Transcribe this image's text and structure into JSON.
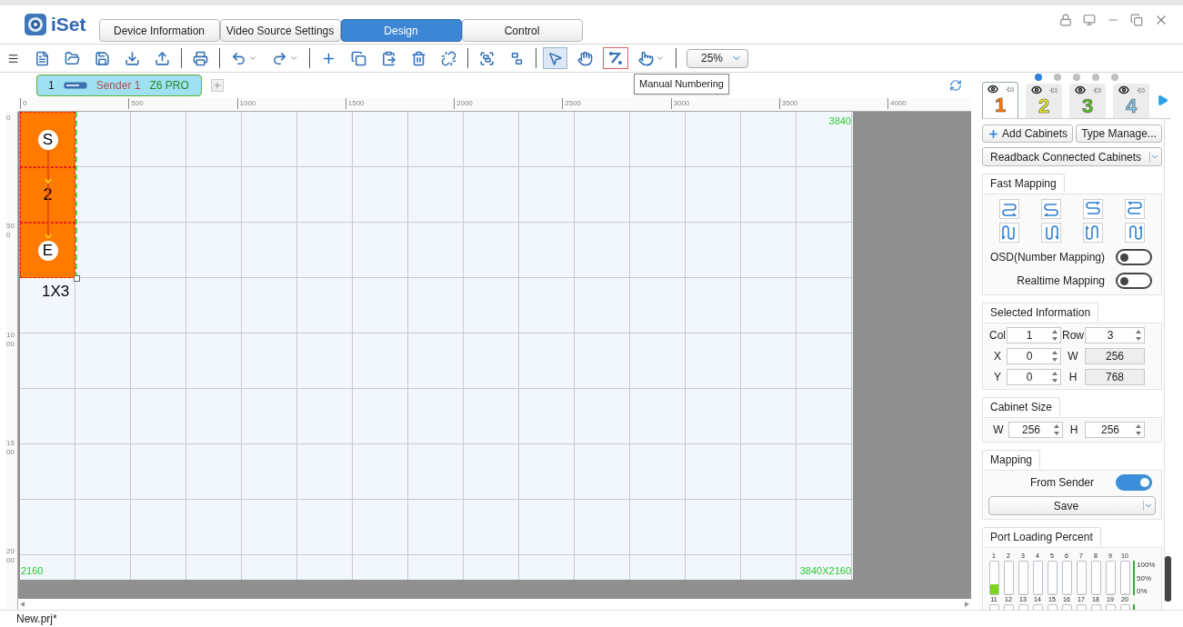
{
  "app": {
    "name": "iSet"
  },
  "tabs": [
    {
      "label": "Device Information",
      "selected": false
    },
    {
      "label": "Video Source Settings",
      "selected": false
    },
    {
      "label": "Design",
      "selected": true
    },
    {
      "label": "Control",
      "selected": false
    }
  ],
  "toolbar": {
    "tools": [
      {
        "kind": "new",
        "selected": false,
        "hovered": false
      },
      {
        "kind": "open",
        "selected": false,
        "hovered": false
      },
      {
        "kind": "save",
        "selected": false,
        "hovered": false
      },
      {
        "kind": "import",
        "selected": false,
        "hovered": false
      },
      {
        "kind": "export",
        "selected": false,
        "hovered": false
      },
      {
        "kind": "sep"
      },
      {
        "kind": "print",
        "selected": false,
        "hovered": false
      },
      {
        "kind": "sep"
      },
      {
        "kind": "undo",
        "selected": false,
        "hovered": false
      },
      {
        "kind": "redo",
        "selected": false,
        "hovered": false
      },
      {
        "kind": "sep"
      },
      {
        "kind": "add",
        "selected": false,
        "hovered": false
      },
      {
        "kind": "copy",
        "selected": false,
        "hovered": false
      },
      {
        "kind": "paste",
        "selected": false,
        "hovered": false
      },
      {
        "kind": "delete",
        "selected": false,
        "hovered": false
      },
      {
        "kind": "unlink",
        "selected": false,
        "hovered": false
      },
      {
        "kind": "sep"
      },
      {
        "kind": "group",
        "selected": false,
        "hovered": false
      },
      {
        "kind": "ungroup",
        "selected": false,
        "hovered": false
      },
      {
        "kind": "sep"
      },
      {
        "kind": "select",
        "selected": true,
        "hovered": false
      },
      {
        "kind": "pan",
        "selected": false,
        "hovered": false
      },
      {
        "kind": "numbering",
        "selected": false,
        "hovered": true
      },
      {
        "kind": "touch",
        "selected": false,
        "hovered": false
      },
      {
        "kind": "sep"
      }
    ],
    "zoom": "25%",
    "tooltip": "Manual Numbering"
  },
  "sender_tab": {
    "index": "1",
    "name": "Sender 1",
    "model": "Z6 PRO",
    "selected": true
  },
  "ruler": {
    "x_labels": [
      "0",
      "500",
      "1000",
      "1500",
      "2000",
      "2500",
      "3000",
      "3500",
      "4000"
    ],
    "y_labels": [
      "0",
      "500",
      "1000",
      "1500",
      "2000"
    ]
  },
  "canvas": {
    "width_label": "3840",
    "height_label": "2160",
    "size_label": "3840X2160",
    "cabinets": [
      {
        "label": "S",
        "kind": "start"
      },
      {
        "label": "2",
        "kind": "middle"
      },
      {
        "label": "E",
        "kind": "end"
      }
    ],
    "group_label": "1X3"
  },
  "layers": {
    "pages": [
      {
        "selected": true
      },
      {
        "selected": false
      },
      {
        "selected": false
      },
      {
        "selected": false
      },
      {
        "selected": false
      }
    ],
    "tabs": [
      {
        "label": "1",
        "color": "#ff7b00",
        "selected": true
      },
      {
        "label": "2",
        "color": "#e3e31e",
        "selected": false
      },
      {
        "label": "3",
        "color": "#55c01a",
        "selected": false
      },
      {
        "label": "4",
        "color": "#7cc4ea",
        "selected": false
      }
    ]
  },
  "panel": {
    "add_button": "Add Cabinets",
    "type_button": "Type Manage...",
    "readback_button": "Readback Connected Cabinets",
    "fast_mapping": {
      "title": "Fast Mapping",
      "toggles": [
        {
          "label": "OSD(Number Mapping)",
          "on": false
        },
        {
          "label": "Realtime Mapping",
          "on": false
        }
      ]
    },
    "selected_info": {
      "title": "Selected Information",
      "fields": [
        {
          "label": "Col",
          "value": "1",
          "kind": "spin"
        },
        {
          "label": "Row",
          "value": "3",
          "kind": "spin"
        },
        {
          "label": "X",
          "value": "0",
          "kind": "spin"
        },
        {
          "label": "W",
          "value": "256",
          "kind": "readonly"
        },
        {
          "label": "Y",
          "value": "0",
          "kind": "spin"
        },
        {
          "label": "H",
          "value": "768",
          "kind": "readonly"
        }
      ]
    },
    "cabinet_size": {
      "title": "Cabinet Size",
      "fields": [
        {
          "label": "W",
          "value": "256",
          "kind": "spin"
        },
        {
          "label": "H",
          "value": "256",
          "kind": "spin"
        }
      ]
    },
    "mapping": {
      "title": "Mapping",
      "toggle": {
        "label": "From Sender",
        "on": true
      },
      "save_button": "Save"
    },
    "port_loading": {
      "title": "Port Loading Percent",
      "rows": [
        {
          "ports": [
            {
              "label": "1",
              "level": 0.3
            },
            {
              "label": "2",
              "level": 0
            },
            {
              "label": "3",
              "level": 0
            },
            {
              "label": "4",
              "level": 0
            },
            {
              "label": "5",
              "level": 0
            },
            {
              "label": "6",
              "level": 0
            },
            {
              "label": "7",
              "level": 0
            },
            {
              "label": "8",
              "level": 0
            },
            {
              "label": "9",
              "level": 0
            },
            {
              "label": "10",
              "level": 0
            }
          ],
          "scale": [
            "100%",
            "50%",
            "0%"
          ]
        },
        {
          "ports": [
            {
              "label": "11"
            },
            {
              "label": "12"
            },
            {
              "label": "13"
            },
            {
              "label": "14"
            },
            {
              "label": "15"
            },
            {
              "label": "16"
            },
            {
              "label": "17"
            },
            {
              "label": "18"
            },
            {
              "label": "19"
            },
            {
              "label": "20"
            }
          ],
          "scale": []
        }
      ]
    }
  },
  "status_bar": {
    "file": "New.prj*"
  }
}
